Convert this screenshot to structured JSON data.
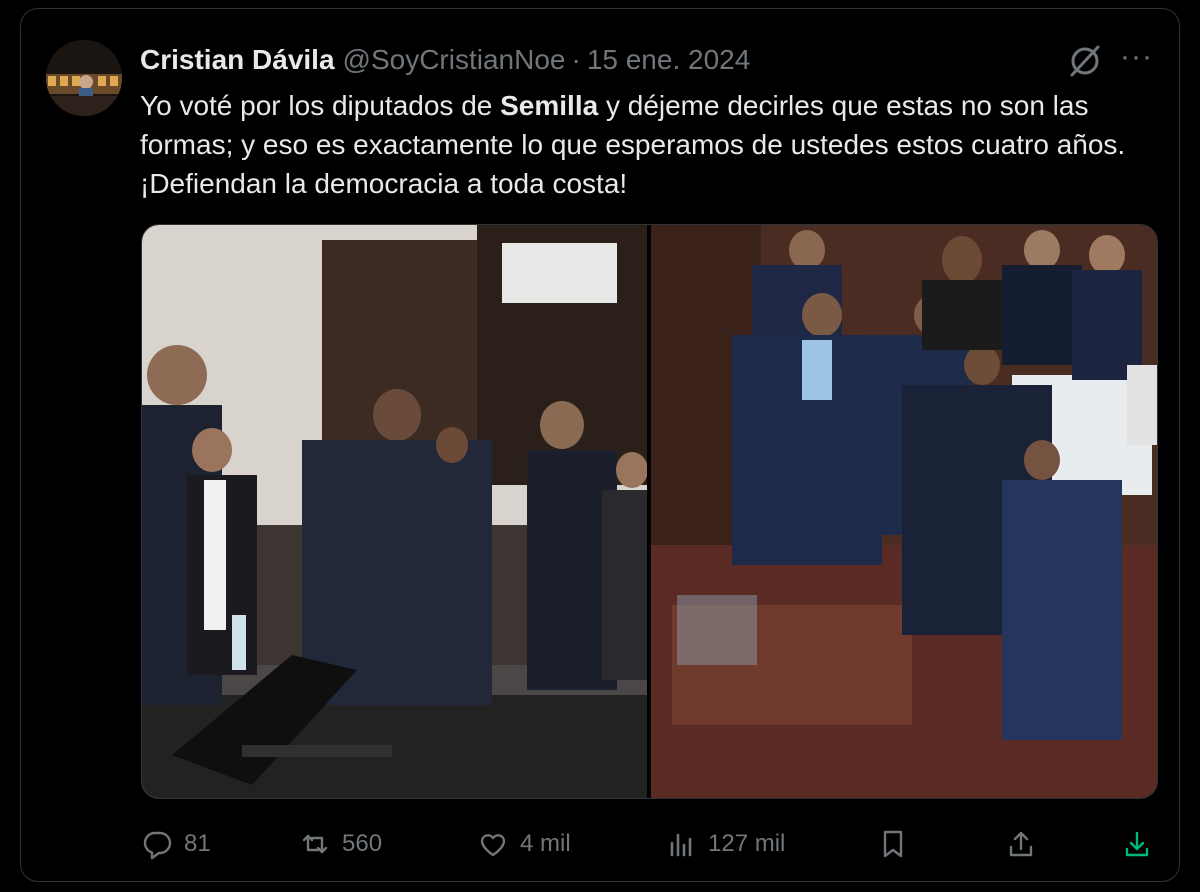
{
  "tweet": {
    "author_name": "Cristian Dávila",
    "handle": "@SoyCristianNoe",
    "separator": "·",
    "date": "15 ene. 2024",
    "text_before_bold": "Yo voté por los diputados de ",
    "text_bold": "Semilla",
    "text_after_bold": " y déjeme decirles que estas no son las formas; y eso es exactamente lo que esperamos de ustedes estos cuatro años. ¡Defiendan la democracia a toda costa!",
    "more_label": "···"
  },
  "actions": {
    "replies": "81",
    "reposts": "560",
    "likes": "4 mil",
    "views": "127 mil"
  },
  "icons": {
    "avatar": "profile-avatar",
    "grok": "grok-icon",
    "more": "more-icon",
    "reply": "reply-icon",
    "repost": "repost-icon",
    "like": "heart-icon",
    "views": "views-icon",
    "bookmark": "bookmark-icon",
    "share": "share-icon",
    "download": "download-icon"
  },
  "colors": {
    "background": "#000000",
    "text": "#e7e9ea",
    "secondary": "#71767b",
    "border": "#2f3336",
    "download_accent": "#00ba7c"
  }
}
